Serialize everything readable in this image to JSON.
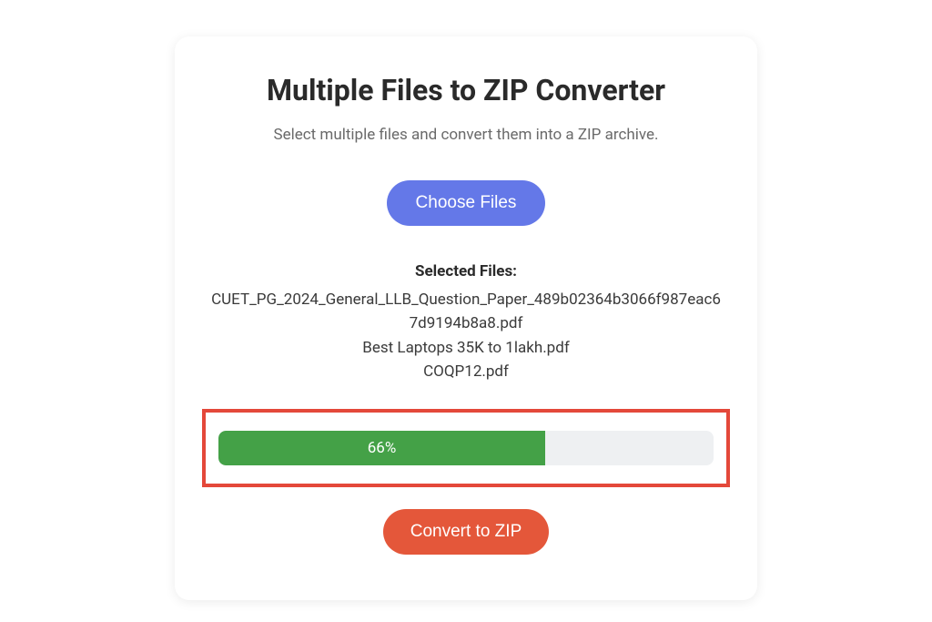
{
  "card": {
    "title": "Multiple Files to ZIP Converter",
    "subtitle": "Select multiple files and convert them into a ZIP archive.",
    "chooseFilesLabel": "Choose Files",
    "selectedFilesLabel": "Selected Files:",
    "files": [
      "CUET_PG_2024_General_LLB_Question_Paper_489b02364b3066f987eac67d9194b8a8.pdf",
      "Best Laptops 35K to 1lakh.pdf",
      "COQP12.pdf"
    ],
    "progress": {
      "percent": 66,
      "label": "66%"
    },
    "convertLabel": "Convert to ZIP",
    "colors": {
      "chooseBtn": "#6478e8",
      "convertBtn": "#e4573a",
      "progressFill": "#44a147",
      "highlightBorder": "#e4483a"
    }
  }
}
